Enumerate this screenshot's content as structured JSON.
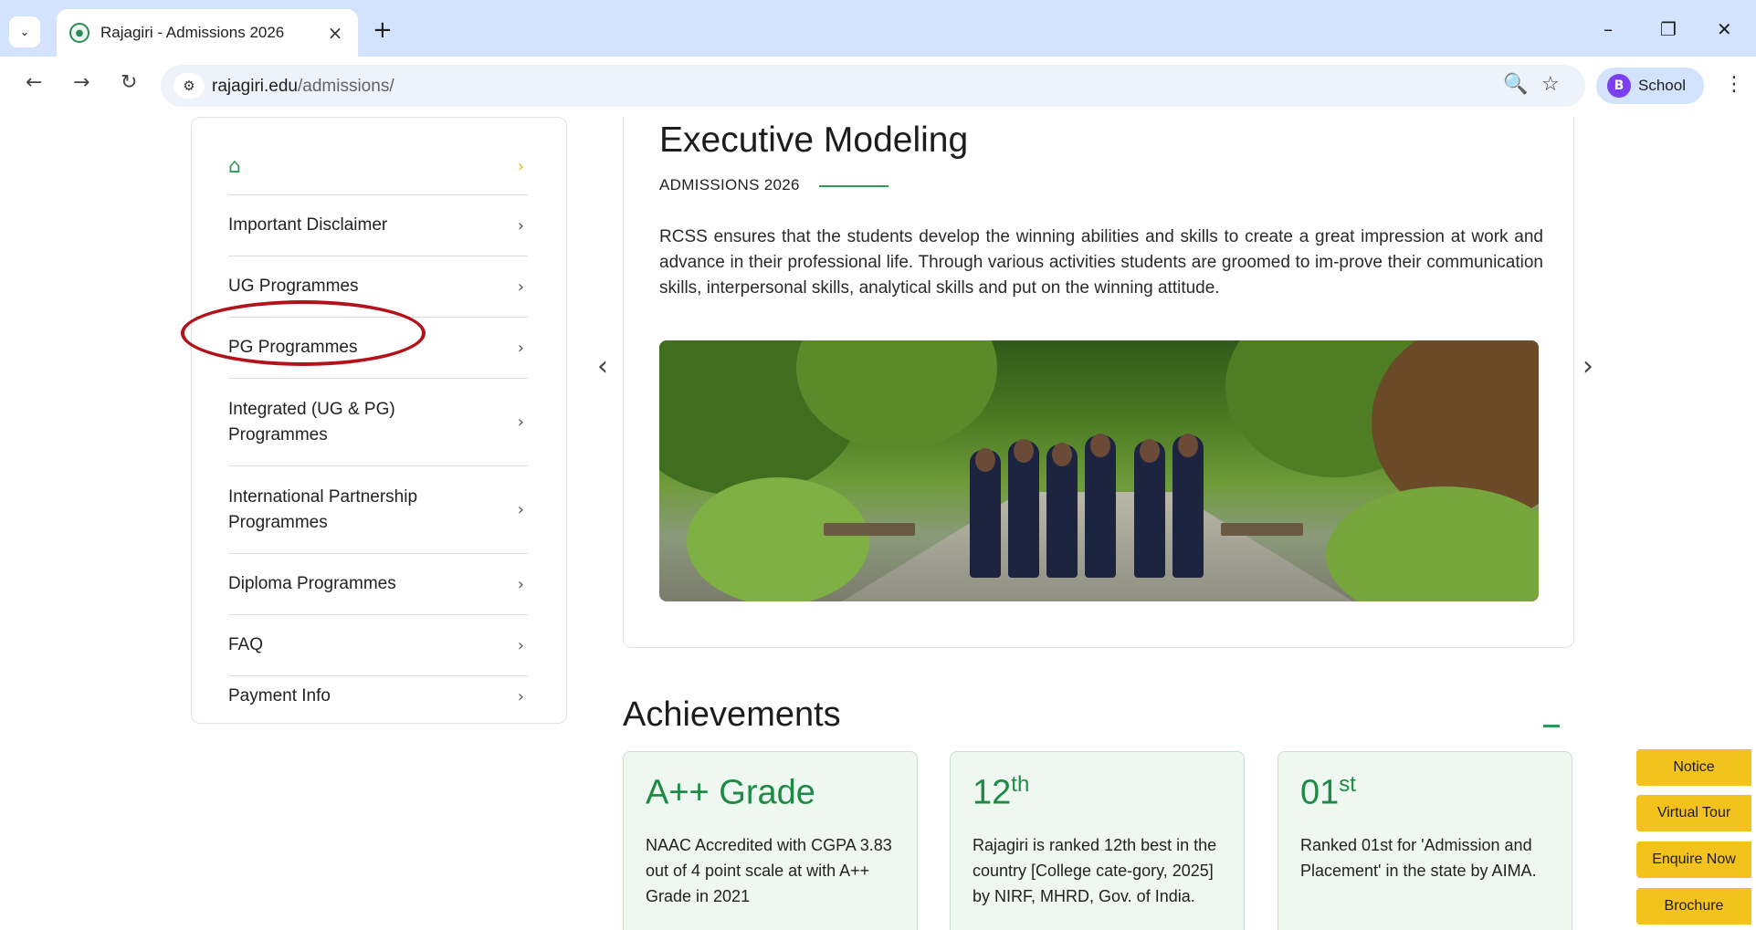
{
  "browser": {
    "tab_title": "Rajagiri - Admissions 2026",
    "url_host": "rajagiri.edu",
    "url_path": "/admissions/",
    "profile_initial": "B",
    "profile_name": "School"
  },
  "sidebar": {
    "items": [
      {
        "label": "Important Disclaimer"
      },
      {
        "label": "UG Programmes"
      },
      {
        "label": "PG Programmes"
      },
      {
        "label": "Integrated (UG & PG) Programmes"
      },
      {
        "label": "International Partnership Programmes"
      },
      {
        "label": "Diploma Programmes"
      },
      {
        "label": "FAQ"
      },
      {
        "label": "Payment Info"
      }
    ],
    "highlighted": "PG Programmes"
  },
  "program": {
    "title": "Executive Modeling",
    "subtitle": "ADMISSIONS 2026",
    "description": "RCSS ensures that the students develop the winning abilities and skills to create a great impression at work and advance in their professional life. Through various activities students are groomed to im-prove their communication skills, interpersonal skills, analytical skills and put on the winning attitude."
  },
  "achievements": {
    "title": "Achievements",
    "cards": [
      {
        "head": "A++ Grade",
        "sup": "",
        "text": "NAAC Accredited with CGPA 3.83 out of 4 point scale at with A++ Grade in 2021"
      },
      {
        "head": "12",
        "sup": "th",
        "text": "Rajagiri is ranked 12th best in the country [College cate-gory, 2025] by NIRF, MHRD, Gov. of India."
      },
      {
        "head": "01",
        "sup": "st",
        "text": "Ranked 01st for 'Admission and Placement' in the state by AIMA."
      }
    ]
  },
  "floating_buttons": [
    "Notice",
    "Virtual Tour",
    "Enquire Now",
    "Brochure"
  ],
  "colors": {
    "accent_green": "#1e8a45",
    "highlight_red": "#b3121a",
    "button_yellow": "#f4c21c"
  }
}
